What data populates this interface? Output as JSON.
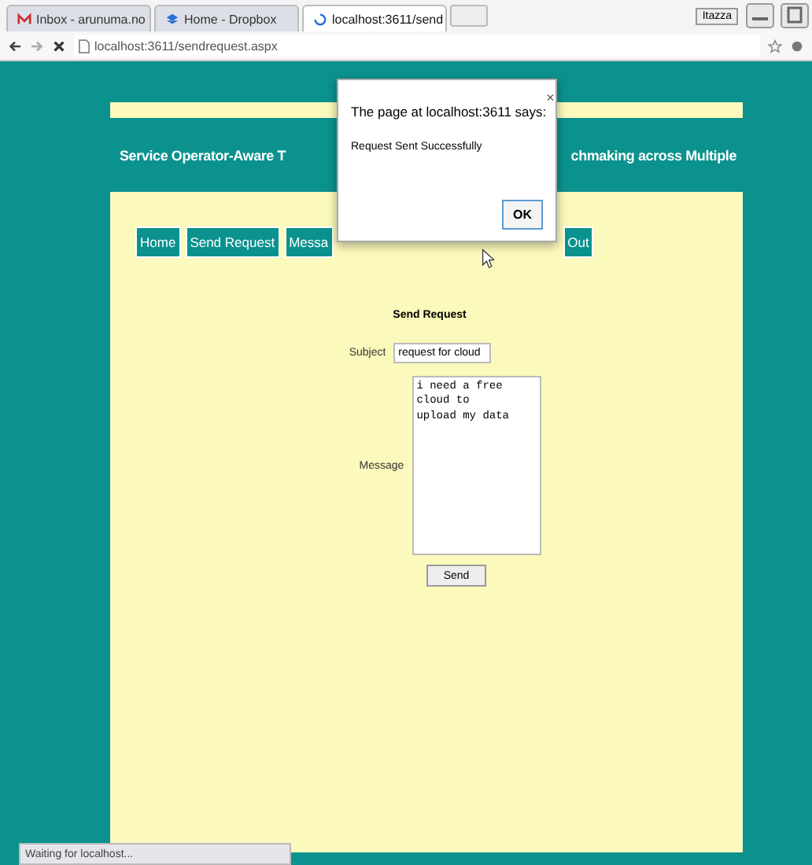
{
  "browser": {
    "tabs": [
      {
        "label": "Inbox - arunuma.no",
        "selected": false
      },
      {
        "label": "Home - Dropbox",
        "selected": false
      },
      {
        "label": "localhost:3611/send",
        "selected": true
      }
    ],
    "user": "Itazza",
    "address": "localhost:3611/sendrequest.aspx"
  },
  "header": {
    "title_left": "Service Operator-Aware T",
    "title_right": "chmaking across Multiple"
  },
  "nav": [
    {
      "label": "Home"
    },
    {
      "label": "Send Request"
    },
    {
      "label": "Messa"
    },
    {
      "label": "Out"
    }
  ],
  "form": {
    "title": "Send Request",
    "subject_label": "Subject",
    "subject_value": "request for cloud",
    "message_label": "Message",
    "message_value": "i need a free cloud to\nupload my data",
    "send": "Send"
  },
  "dialog": {
    "title": "The page at localhost:3611 says:",
    "close": "×",
    "message": "Request Sent Successfully",
    "ok": "OK"
  },
  "status_bar": "Waiting for localhost..."
}
